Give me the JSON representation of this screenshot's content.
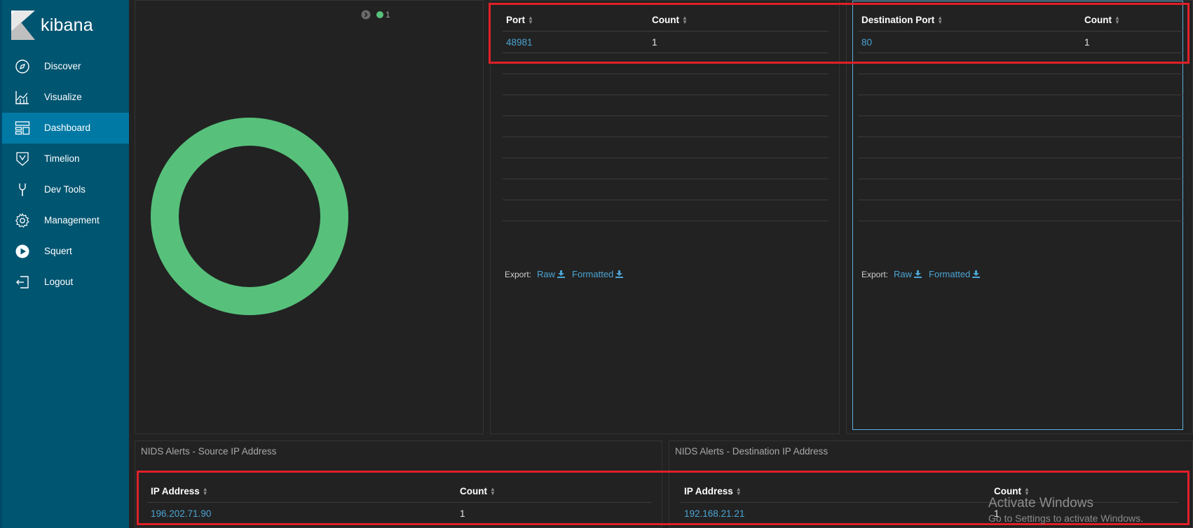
{
  "app": {
    "logo_text": "kibana"
  },
  "nav": [
    {
      "label": "Discover",
      "icon": "compass-icon"
    },
    {
      "label": "Visualize",
      "icon": "chart-icon"
    },
    {
      "label": "Dashboard",
      "icon": "dashboard-icon",
      "active": true
    },
    {
      "label": "Timelion",
      "icon": "timelion-icon"
    },
    {
      "label": "Dev Tools",
      "icon": "wrench-icon"
    },
    {
      "label": "Management",
      "icon": "gear-icon"
    },
    {
      "label": "Squert",
      "icon": "play-icon"
    },
    {
      "label": "Logout",
      "icon": "logout-icon"
    }
  ],
  "donut_panel": {
    "legend_count": "1",
    "slice_color": "#57c17b"
  },
  "source_port_table": {
    "headers": [
      "Port",
      "Count"
    ],
    "rows": [
      {
        "value": "48981",
        "count": "1"
      }
    ],
    "export_label": "Export:",
    "raw_label": "Raw",
    "formatted_label": "Formatted"
  },
  "dest_port_table": {
    "headers": [
      "Destination Port",
      "Count"
    ],
    "rows": [
      {
        "value": "80",
        "count": "1"
      }
    ],
    "export_label": "Export:",
    "raw_label": "Raw",
    "formatted_label": "Formatted"
  },
  "source_ip_panel": {
    "title": "NIDS Alerts - Source IP Address",
    "headers": [
      "IP Address",
      "Count"
    ],
    "rows": [
      {
        "value": "196.202.71.90",
        "count": "1"
      }
    ]
  },
  "dest_ip_panel": {
    "title": "NIDS Alerts - Destination IP Address",
    "headers": [
      "IP Address",
      "Count"
    ],
    "rows": [
      {
        "value": "192.168.21.21",
        "count": "1"
      }
    ]
  },
  "watermark": {
    "line1": "Activate Windows",
    "line2": "Go to Settings to activate Windows."
  },
  "colors": {
    "sidebar": "#005571",
    "active": "#0079a5",
    "link": "#4ba4d3",
    "highlight": "#e02028"
  }
}
